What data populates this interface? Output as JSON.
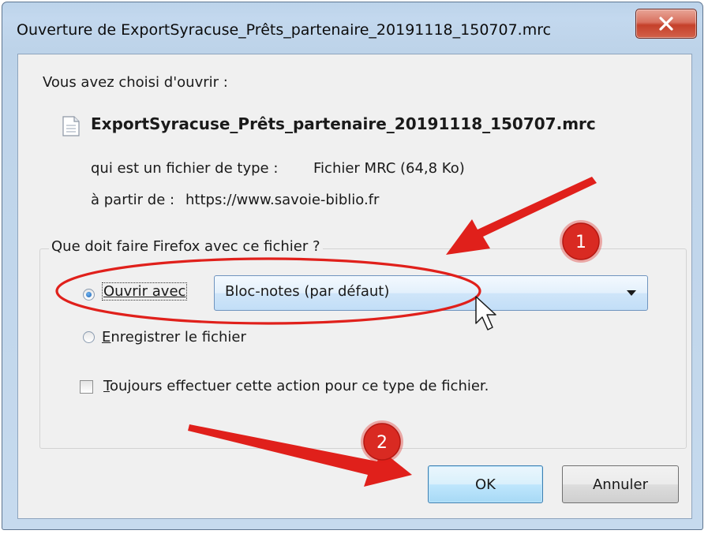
{
  "window": {
    "title": "Ouverture de ExportSyracuse_Prêts_partenaire_20191118_150707.mrc",
    "close_glyph": "X"
  },
  "dialog": {
    "intro": "Vous avez choisi d'ouvrir :",
    "file_icon": "document-icon",
    "filename": "ExportSyracuse_Prêts_partenaire_20191118_150707.mrc",
    "type_label": "qui est un fichier de type :",
    "type_value": "Fichier MRC (64,8 Ko)",
    "source_label": "à partir de :",
    "source_value": "https://www.savoie-biblio.fr",
    "question": "Que doit faire Firefox avec ce fichier ?",
    "open_with": {
      "access_key": "O",
      "label_rest": "uvrir avec",
      "checked": true,
      "selected_app": "Bloc-notes (par défaut)"
    },
    "save_file": {
      "access_key": "E",
      "label_rest": "nregistrer le fichier",
      "checked": false
    },
    "always": {
      "access_key": "T",
      "label_rest": "oujours effectuer cette action pour ce type de fichier.",
      "checked": false
    },
    "ok_label": "OK",
    "cancel_label": "Annuler"
  },
  "annotations": {
    "badge_1": "1",
    "badge_2": "2",
    "accent_red": "#e0201b",
    "badge_color": "#d92a22"
  }
}
